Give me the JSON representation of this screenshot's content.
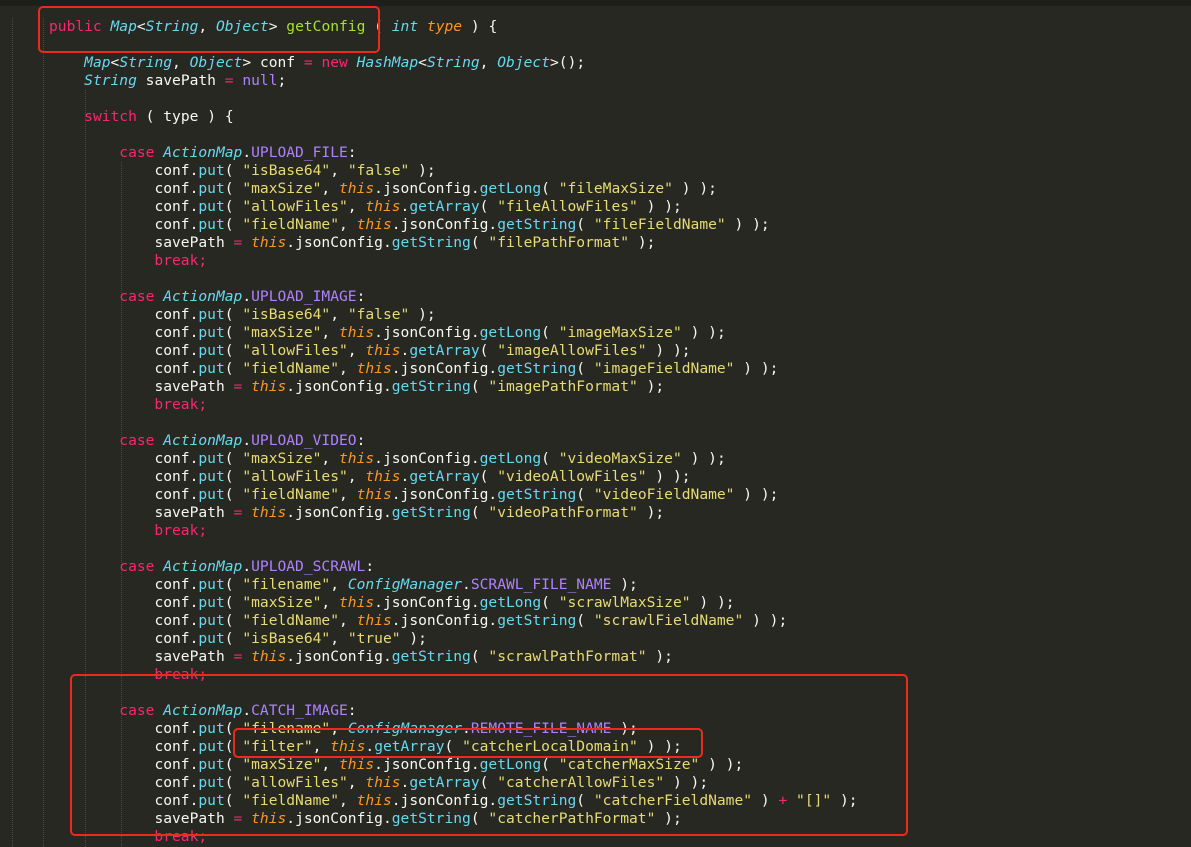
{
  "editor": {
    "theme_colors": {
      "background": "#272822",
      "keyword": "#f92672",
      "type": "#66d9ef",
      "function": "#a6e22e",
      "parameter": "#fd971f",
      "string": "#e6db74",
      "constant": "#ae81ff",
      "highlight_box": "#ec2a1e"
    },
    "lines": [
      "public Map<String, Object> getConfig ( int type ) {",
      "",
      "    Map<String, Object> conf = new HashMap<String, Object>();",
      "    String savePath = null;",
      "",
      "    switch ( type ) {",
      "",
      "        case ActionMap.UPLOAD_FILE:",
      "            conf.put( \"isBase64\", \"false\" );",
      "            conf.put( \"maxSize\", this.jsonConfig.getLong( \"fileMaxSize\" ) );",
      "            conf.put( \"allowFiles\", this.getArray( \"fileAllowFiles\" ) );",
      "            conf.put( \"fieldName\", this.jsonConfig.getString( \"fileFieldName\" ) );",
      "            savePath = this.jsonConfig.getString( \"filePathFormat\" );",
      "            break;",
      "",
      "        case ActionMap.UPLOAD_IMAGE:",
      "            conf.put( \"isBase64\", \"false\" );",
      "            conf.put( \"maxSize\", this.jsonConfig.getLong( \"imageMaxSize\" ) );",
      "            conf.put( \"allowFiles\", this.getArray( \"imageAllowFiles\" ) );",
      "            conf.put( \"fieldName\", this.jsonConfig.getString( \"imageFieldName\" ) );",
      "            savePath = this.jsonConfig.getString( \"imagePathFormat\" );",
      "            break;",
      "",
      "        case ActionMap.UPLOAD_VIDEO:",
      "            conf.put( \"maxSize\", this.jsonConfig.getLong( \"videoMaxSize\" ) );",
      "            conf.put( \"allowFiles\", this.getArray( \"videoAllowFiles\" ) );",
      "            conf.put( \"fieldName\", this.jsonConfig.getString( \"videoFieldName\" ) );",
      "            savePath = this.jsonConfig.getString( \"videoPathFormat\" );",
      "            break;",
      "",
      "        case ActionMap.UPLOAD_SCRAWL:",
      "            conf.put( \"filename\", ConfigManager.SCRAWL_FILE_NAME );",
      "            conf.put( \"maxSize\", this.jsonConfig.getLong( \"scrawlMaxSize\" ) );",
      "            conf.put( \"fieldName\", this.jsonConfig.getString( \"scrawlFieldName\" ) );",
      "            conf.put( \"isBase64\", \"true\" );",
      "            savePath = this.jsonConfig.getString( \"scrawlPathFormat\" );",
      "            break;",
      "",
      "        case ActionMap.CATCH_IMAGE:",
      "            conf.put( \"filename\", ConfigManager.REMOTE_FILE_NAME );",
      "            conf.put( \"filter\", this.getArray( \"catcherLocalDomain\" ) );",
      "            conf.put( \"maxSize\", this.jsonConfig.getLong( \"catcherMaxSize\" ) );",
      "            conf.put( \"allowFiles\", this.getArray( \"catcherAllowFiles\" ) );",
      "            conf.put( \"fieldName\", this.jsonConfig.getString( \"catcherFieldName\" ) + \"[]\" );",
      "            savePath = this.jsonConfig.getString( \"catcherPathFormat\" );",
      "            break;"
    ]
  }
}
